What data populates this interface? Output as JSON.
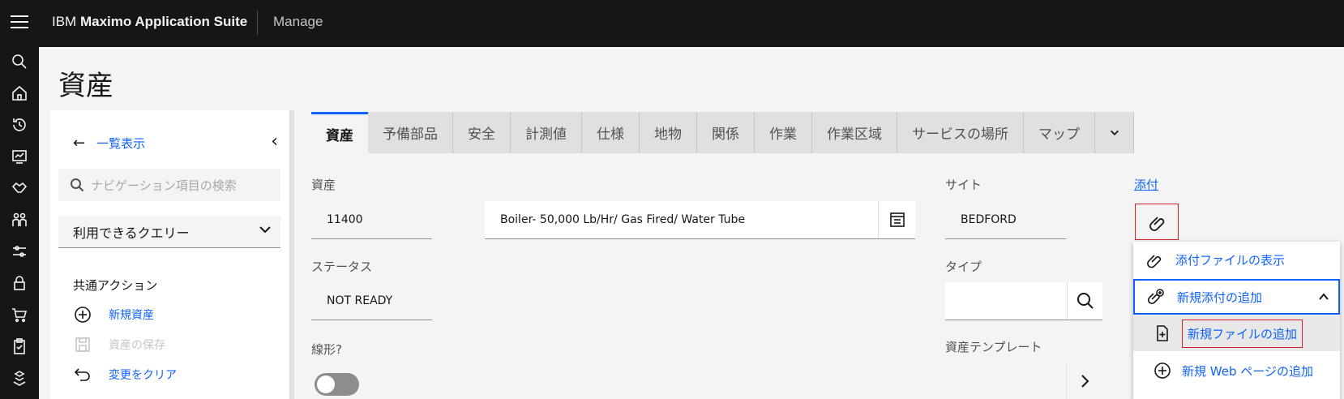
{
  "header": {
    "brand_prefix": "IBM",
    "brand_name": "Maximo Application Suite",
    "app": "Manage"
  },
  "rail": {
    "icons": [
      "search-icon",
      "home-icon",
      "history-icon",
      "dashboard-icon",
      "handshake-icon",
      "people-icon",
      "sliders-icon",
      "lock-icon",
      "cart-icon",
      "clipboard-icon",
      "boxes-icon"
    ]
  },
  "page": {
    "title": "資産"
  },
  "sidenav": {
    "back_label": "一覧表示",
    "search_placeholder": "ナビゲーション項目の検索",
    "query_label": "利用できるクエリー",
    "section_label": "共通アクション",
    "actions": [
      {
        "label": "新規資産",
        "enabled": true,
        "icon": "add-circle-icon"
      },
      {
        "label": "資産の保存",
        "enabled": false,
        "icon": "save-icon"
      },
      {
        "label": "変更をクリア",
        "enabled": true,
        "icon": "undo-icon"
      }
    ]
  },
  "tabs": [
    {
      "label": "資産",
      "active": true
    },
    {
      "label": "予備部品"
    },
    {
      "label": "安全"
    },
    {
      "label": "計測値"
    },
    {
      "label": "仕様"
    },
    {
      "label": "地物"
    },
    {
      "label": "関係"
    },
    {
      "label": "作業"
    },
    {
      "label": "作業区域"
    },
    {
      "label": "サービスの場所"
    },
    {
      "label": "マップ"
    }
  ],
  "form": {
    "asset_label": "資産",
    "asset_value": "11400",
    "description_value": "Boiler- 50,000 Lb/Hr/ Gas Fired/ Water Tube",
    "site_label": "サイト",
    "site_value": "BEDFORD",
    "status_label": "ステータス",
    "status_value": "NOT READY",
    "type_label": "タイプ",
    "type_value": "",
    "linear_label": "線形?",
    "linear_on": false,
    "template_label": "資産テンプレート"
  },
  "attachments": {
    "link_label": "添付",
    "menu": {
      "view_label": "添付ファイルの表示",
      "add_label": "新規添付の追加",
      "add_file_label": "新規ファイルの追加",
      "add_web_label": "新規 Web ページの追加"
    }
  },
  "colors": {
    "header_bg": "#161616",
    "accent": "#0f62fe",
    "highlight_border": "#da1e28"
  }
}
